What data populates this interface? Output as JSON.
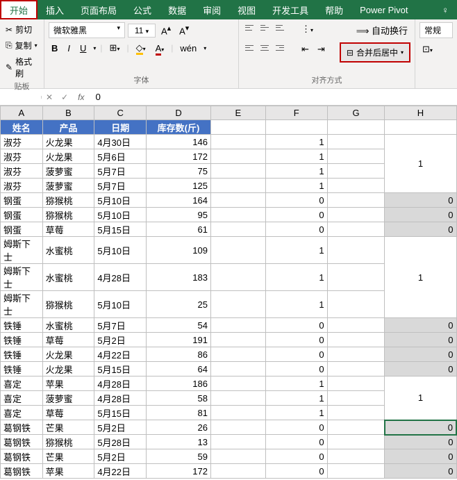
{
  "ribbon": {
    "tabs": [
      "开始",
      "插入",
      "页面布局",
      "公式",
      "数据",
      "审阅",
      "视图",
      "开发工具",
      "帮助",
      "Power Pivot"
    ],
    "clipboard": {
      "cut": "剪切",
      "copy": "复制",
      "paint": "格式刷",
      "group_label": "贴板"
    },
    "font": {
      "name": "微软雅黑",
      "size": "11",
      "bold": "B",
      "italic": "I",
      "underline": "U",
      "wen": "wén",
      "group_label": "字体"
    },
    "align": {
      "wrap": "自动换行",
      "merge": "合并后居中",
      "group_label": "对齐方式"
    },
    "number": {
      "general": "常规"
    }
  },
  "formula_bar": {
    "fx": "fx",
    "value": "0"
  },
  "columns": [
    "A",
    "B",
    "C",
    "D",
    "E",
    "F",
    "G",
    "H"
  ],
  "headers": {
    "A": "姓名",
    "B": "产品",
    "C": "日期",
    "D": "库存数(斤)"
  },
  "chart_data": {
    "type": "table",
    "columns": [
      "姓名",
      "产品",
      "日期",
      "库存数(斤)",
      "F",
      "H"
    ],
    "rows": [
      {
        "name": "淑芬",
        "product": "火龙果",
        "date": "4月30日",
        "stock": 146,
        "f": 1,
        "h": 1,
        "h_merge": 4
      },
      {
        "name": "淑芬",
        "product": "火龙果",
        "date": "5月6日",
        "stock": 172,
        "f": 1
      },
      {
        "name": "淑芬",
        "product": "菠萝蜜",
        "date": "5月7日",
        "stock": 75,
        "f": 1
      },
      {
        "name": "淑芬",
        "product": "菠萝蜜",
        "date": "5月7日",
        "stock": 125,
        "f": 1
      },
      {
        "name": "钢蛋",
        "product": "猕猴桃",
        "date": "5月10日",
        "stock": 164,
        "f": 0,
        "h": 0,
        "h_gray": true
      },
      {
        "name": "钢蛋",
        "product": "猕猴桃",
        "date": "5月10日",
        "stock": 95,
        "f": 0,
        "h": 0,
        "h_gray": true
      },
      {
        "name": "钢蛋",
        "product": "草莓",
        "date": "5月15日",
        "stock": 61,
        "f": 0,
        "h": 0,
        "h_gray": true
      },
      {
        "name": "姆斯下士",
        "product": "水蜜桃",
        "date": "5月10日",
        "stock": 109,
        "f": 1,
        "h": 1,
        "h_merge": 3
      },
      {
        "name": "姆斯下士",
        "product": "水蜜桃",
        "date": "4月28日",
        "stock": 183,
        "f": 1
      },
      {
        "name": "姆斯下士",
        "product": "猕猴桃",
        "date": "5月10日",
        "stock": 25,
        "f": 1
      },
      {
        "name": "铁锤",
        "product": "水蜜桃",
        "date": "5月7日",
        "stock": 54,
        "f": 0,
        "h": 0,
        "h_gray": true
      },
      {
        "name": "铁锤",
        "product": "草莓",
        "date": "5月2日",
        "stock": 191,
        "f": 0,
        "h": 0,
        "h_gray": true
      },
      {
        "name": "铁锤",
        "product": "火龙果",
        "date": "4月22日",
        "stock": 86,
        "f": 0,
        "h": 0,
        "h_gray": true
      },
      {
        "name": "铁锤",
        "product": "火龙果",
        "date": "5月15日",
        "stock": 64,
        "f": 0,
        "h": 0,
        "h_gray": true
      },
      {
        "name": "喜定",
        "product": "苹果",
        "date": "4月28日",
        "stock": 186,
        "f": 1,
        "h": 1,
        "h_merge": 3
      },
      {
        "name": "喜定",
        "product": "菠萝蜜",
        "date": "4月28日",
        "stock": 58,
        "f": 1
      },
      {
        "name": "喜定",
        "product": "草莓",
        "date": "5月15日",
        "stock": 81,
        "f": 1
      },
      {
        "name": "葛钢铁",
        "product": "芒果",
        "date": "5月2日",
        "stock": 26,
        "f": 0,
        "h": 0,
        "h_gray": true,
        "selected": true
      },
      {
        "name": "葛钢铁",
        "product": "猕猴桃",
        "date": "5月28日",
        "stock": 13,
        "f": 0,
        "h": 0,
        "h_gray": true
      },
      {
        "name": "葛钢铁",
        "product": "芒果",
        "date": "5月2日",
        "stock": 59,
        "f": 0,
        "h": 0,
        "h_gray": true
      },
      {
        "name": "葛钢铁",
        "product": "苹果",
        "date": "4月22日",
        "stock": 172,
        "f": 0,
        "h": 0,
        "h_gray": true
      }
    ]
  }
}
